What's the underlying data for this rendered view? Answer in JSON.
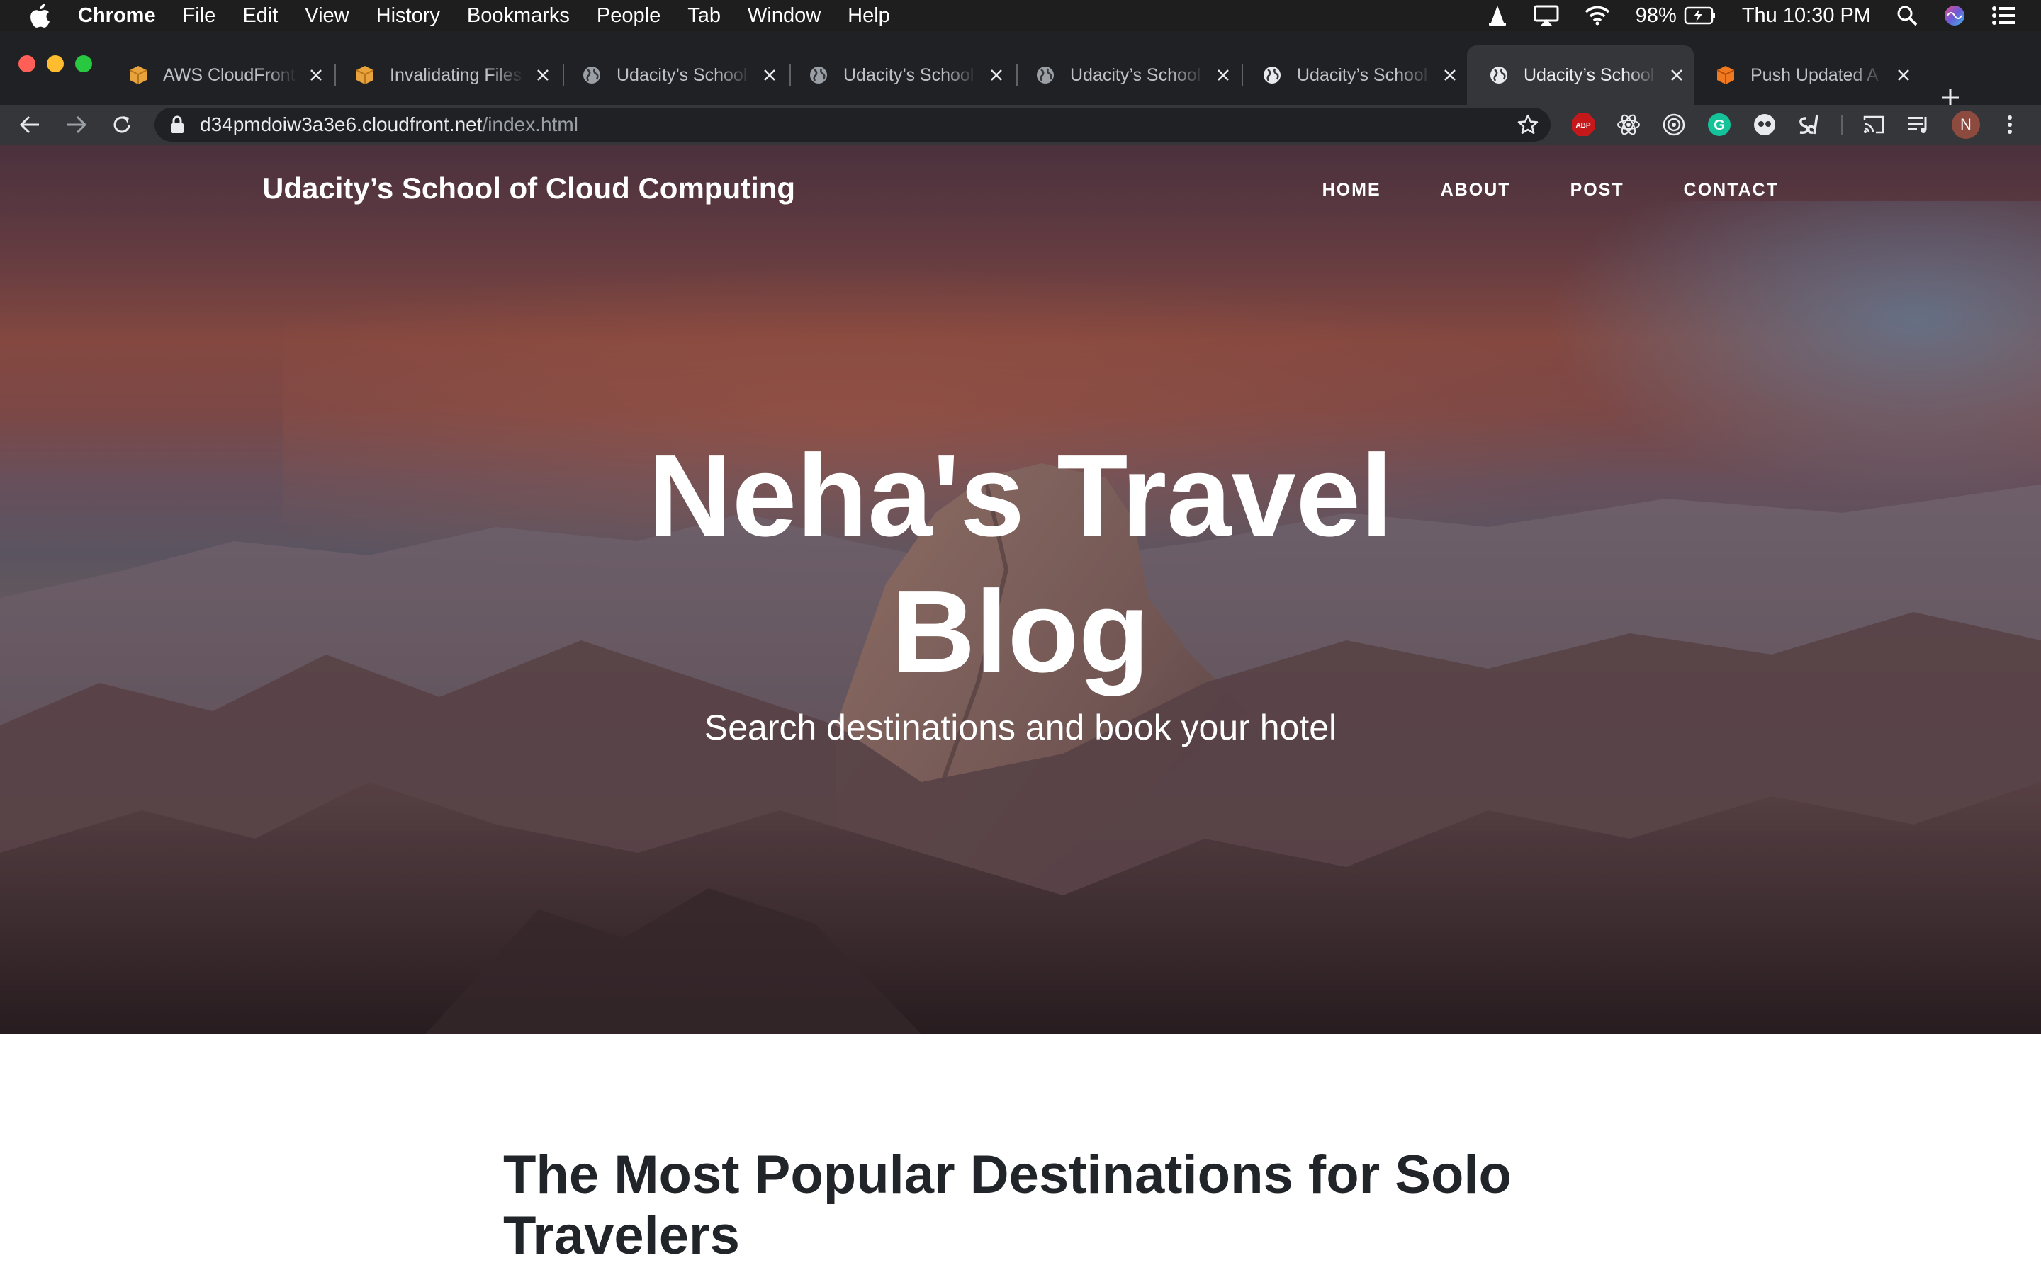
{
  "menubar": {
    "app_name": "Chrome",
    "items": [
      "File",
      "Edit",
      "View",
      "History",
      "Bookmarks",
      "People",
      "Tab",
      "Window",
      "Help"
    ],
    "battery": "98%",
    "clock": "Thu 10:30 PM"
  },
  "tabs": [
    {
      "title": "AWS CloudFront",
      "icon": "aws-box-icon"
    },
    {
      "title": "Invalidating Files",
      "icon": "aws-box-icon"
    },
    {
      "title": "Udacity’s School",
      "icon": "globe-icon"
    },
    {
      "title": "Udacity’s School",
      "icon": "globe-icon"
    },
    {
      "title": "Udacity’s School",
      "icon": "globe-icon"
    },
    {
      "title": "Udacity’s School",
      "icon": "globe-icon"
    },
    {
      "title": "Udacity’s School",
      "icon": "globe-icon",
      "active": true
    },
    {
      "title": "Push Updated A",
      "icon": "package-icon"
    }
  ],
  "address": {
    "host": "d34pmdoiw3a3e6.cloudfront.net",
    "path": "/index.html"
  },
  "extensions": [
    "ABP",
    "G",
    "N"
  ],
  "site": {
    "brand": "Udacity’s School of Cloud Computing",
    "nav": [
      "HOME",
      "ABOUT",
      "POST",
      "CONTACT"
    ],
    "hero_title_line1": "Neha's Travel",
    "hero_title_line2": "Blog",
    "hero_subtitle": "Search destinations and book your hotel",
    "post_title": "The Most Popular Destinations for Solo Travelers"
  },
  "colors": {
    "menubar_bg": "#1e1e1e",
    "tabstrip_bg": "#202124",
    "active_tab_bg": "#35363a",
    "omnibox_bg": "#202124",
    "heading_text": "#212529"
  }
}
